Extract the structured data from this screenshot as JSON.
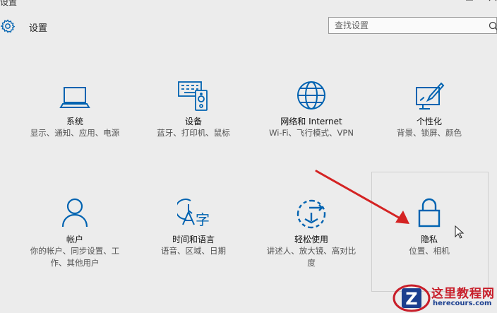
{
  "window": {
    "title": "设置"
  },
  "header": {
    "title": "设置"
  },
  "search": {
    "placeholder": "查找设置"
  },
  "tiles": [
    {
      "title": "系统",
      "subtitle": "显示、通知、应用、电源",
      "icon": "laptop-icon"
    },
    {
      "title": "设备",
      "subtitle": "蓝牙、打印机、鼠标",
      "icon": "devices-icon"
    },
    {
      "title": "网络和 Internet",
      "subtitle": "Wi-Fi、飞行模式、VPN",
      "icon": "globe-icon"
    },
    {
      "title": "个性化",
      "subtitle": "背景、锁屏、颜色",
      "icon": "personalize-icon"
    },
    {
      "title": "帐户",
      "subtitle": "你的帐户、同步设置、工作、其他用户",
      "icon": "person-icon"
    },
    {
      "title": "时间和语言",
      "subtitle": "语音、区域、日期",
      "icon": "time-language-icon"
    },
    {
      "title": "轻松使用",
      "subtitle": "讲述人、放大镜、高对比度",
      "icon": "ease-of-access-icon"
    },
    {
      "title": "隐私",
      "subtitle": "位置、相机",
      "icon": "lock-icon"
    }
  ],
  "watermark": {
    "name": "这里教程网",
    "url": "herecours.com"
  },
  "colors": {
    "accent": "#0063b1",
    "arrow": "#d42323",
    "background": "#ececec"
  }
}
